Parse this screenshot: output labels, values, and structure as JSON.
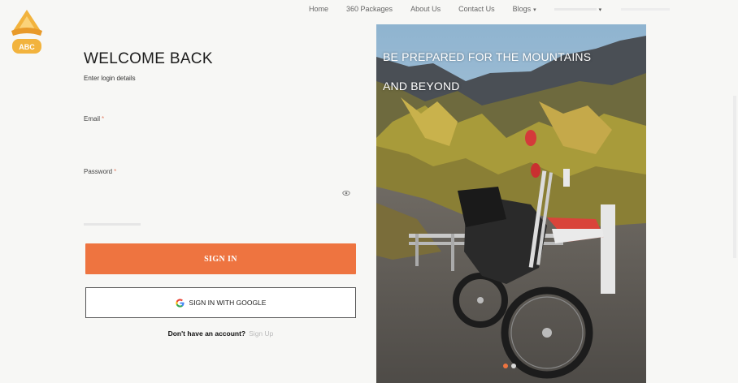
{
  "nav": {
    "items": [
      {
        "label": "Home"
      },
      {
        "label": "360 Packages"
      },
      {
        "label": "About Us"
      },
      {
        "label": "Contact Us"
      },
      {
        "label": "Blogs"
      }
    ],
    "dropdown_caret": "▾"
  },
  "login": {
    "title": "WELCOME BACK",
    "subtitle": "Enter login details",
    "email_label": "Email",
    "password_label": "Password",
    "required_mark": "*",
    "signin_label": "SIGN IN",
    "google_label": "SIGN IN WITH GOOGLE",
    "no_account_text": "Don't have an account?",
    "signup_link": "Sign Up"
  },
  "hero": {
    "caption_line1": "BE PREPARED FOR THE MOUNTAINS",
    "caption_line2": "AND BEYOND",
    "slides": [
      {
        "active": true
      },
      {
        "active": false
      }
    ]
  },
  "colors": {
    "accent": "#ee7440",
    "logo_gold": "#f2b33d",
    "background": "#f7f7f5"
  }
}
